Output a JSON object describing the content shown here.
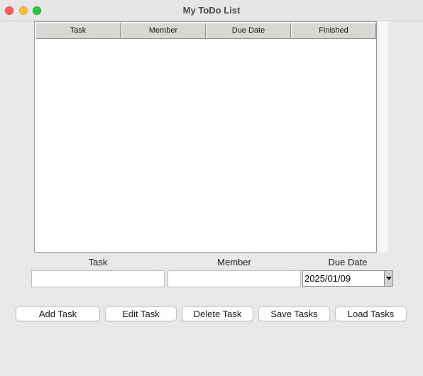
{
  "window": {
    "title": "My ToDo List"
  },
  "table": {
    "columns": [
      "Task",
      "Member",
      "Due Date",
      "Finished"
    ],
    "rows": []
  },
  "form": {
    "task_label": "Task",
    "member_label": "Member",
    "due_date_label": "Due Date",
    "task_value": "",
    "member_value": "",
    "due_date_value": "2025/01/09"
  },
  "buttons": {
    "add": "Add Task",
    "edit": "Edit Task",
    "delete": "Delete Task",
    "save": "Save Tasks",
    "load": "Load Tasks"
  },
  "colors": {
    "close": "#fe5f57",
    "minimize": "#febc2e",
    "maximize": "#28c840"
  }
}
